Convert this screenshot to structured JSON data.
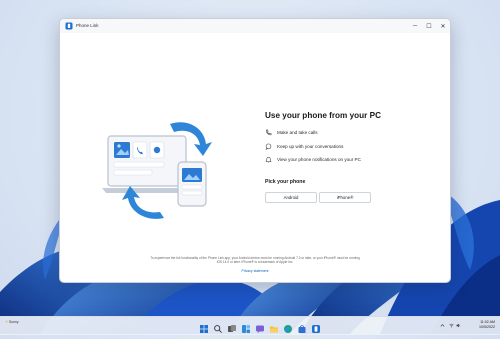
{
  "window": {
    "title": "Phone Link",
    "minimize_label": "─",
    "maximize_label": "☐",
    "close_label": "✕"
  },
  "main": {
    "heading": "Use your phone from your PC",
    "features": [
      {
        "icon": "phone-call-icon",
        "label": "Make and take calls"
      },
      {
        "icon": "chat-bubble-icon",
        "label": "Keep up with your conversations"
      },
      {
        "icon": "bell-icon",
        "label": "View your phone notifications on your PC"
      }
    ],
    "pick_label": "Pick your phone",
    "android_button": "Android",
    "iphone_button": "iPhone®",
    "footnote": "To experience the full functionality of the Phone Link app, your Android device must be running Android 7.0 or later, or your iPhone® must be running iOS 14.0 or later. iPhone® is a trademark of Apple Inc.",
    "privacy_link": "Privacy statement"
  },
  "taskbar": {
    "weather": "Sunny",
    "time": "11:02 AM",
    "date": "10/5/2022",
    "apps": [
      "start-icon",
      "search-icon",
      "task-view-icon",
      "widgets-icon",
      "chat-icon",
      "file-explorer-icon",
      "edge-icon",
      "store-icon",
      "phone-link-icon"
    ]
  },
  "colors": {
    "accent": "#0a66c2",
    "window_bg": "#ffffff",
    "taskbar_bg": "#eef2f8",
    "bloom_dark": "#0b3a9c",
    "bloom_light": "#4a8fe8"
  }
}
